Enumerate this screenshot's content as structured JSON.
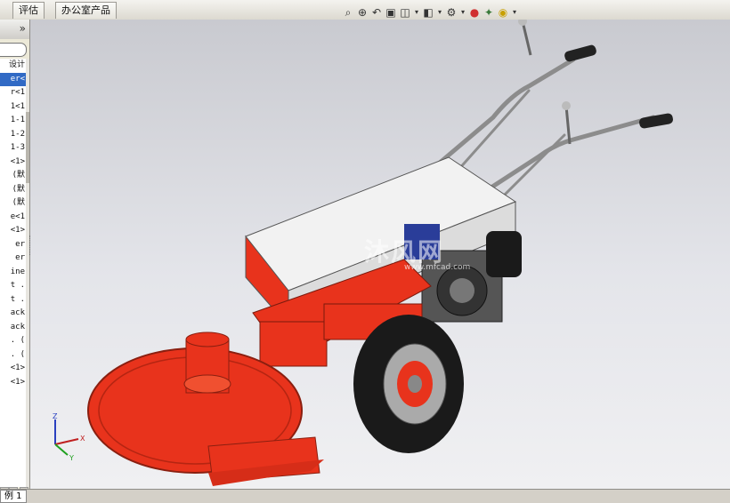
{
  "toolbar": {
    "tabs": [
      "评估",
      "办公室产品"
    ],
    "icons": [
      "zoom-fit-icon",
      "zoom-area-icon",
      "previous-view-icon",
      "section-view-icon",
      "view-orientation-icon",
      "display-style-icon",
      "hide-show-icon",
      "edit-appearance-icon",
      "apply-scene-icon",
      "view-settings-icon"
    ]
  },
  "feature_tree": {
    "collapse_label": "»",
    "items": [
      "设计",
      "er<",
      "r<1",
      "1<1",
      "1-1",
      "1-2",
      "1-3",
      "<1>",
      "(默",
      "(默",
      "(默",
      "e<1",
      "<1>",
      "er",
      "er",
      "ine",
      "t .",
      "t .",
      "ack",
      "ack",
      ". (",
      ". (",
      "<1>",
      "<1>"
    ],
    "selected_index": 1
  },
  "viewport": {
    "watermark_text": "沐风网",
    "watermark_url": "www.mfcad.com",
    "triad": {
      "x_label": "X",
      "y_label": "Y",
      "z_label": "Z"
    }
  },
  "bottom": {
    "sheet_tab": "例 1",
    "scroll_left": "◀",
    "scroll_right": "▶",
    "scroll_down": "▼"
  },
  "colors": {
    "machine_orange": "#e8331c",
    "hood_white": "#f2f2f2",
    "tire_black": "#1a1a1a",
    "frame_grey": "#9a9a9a"
  }
}
